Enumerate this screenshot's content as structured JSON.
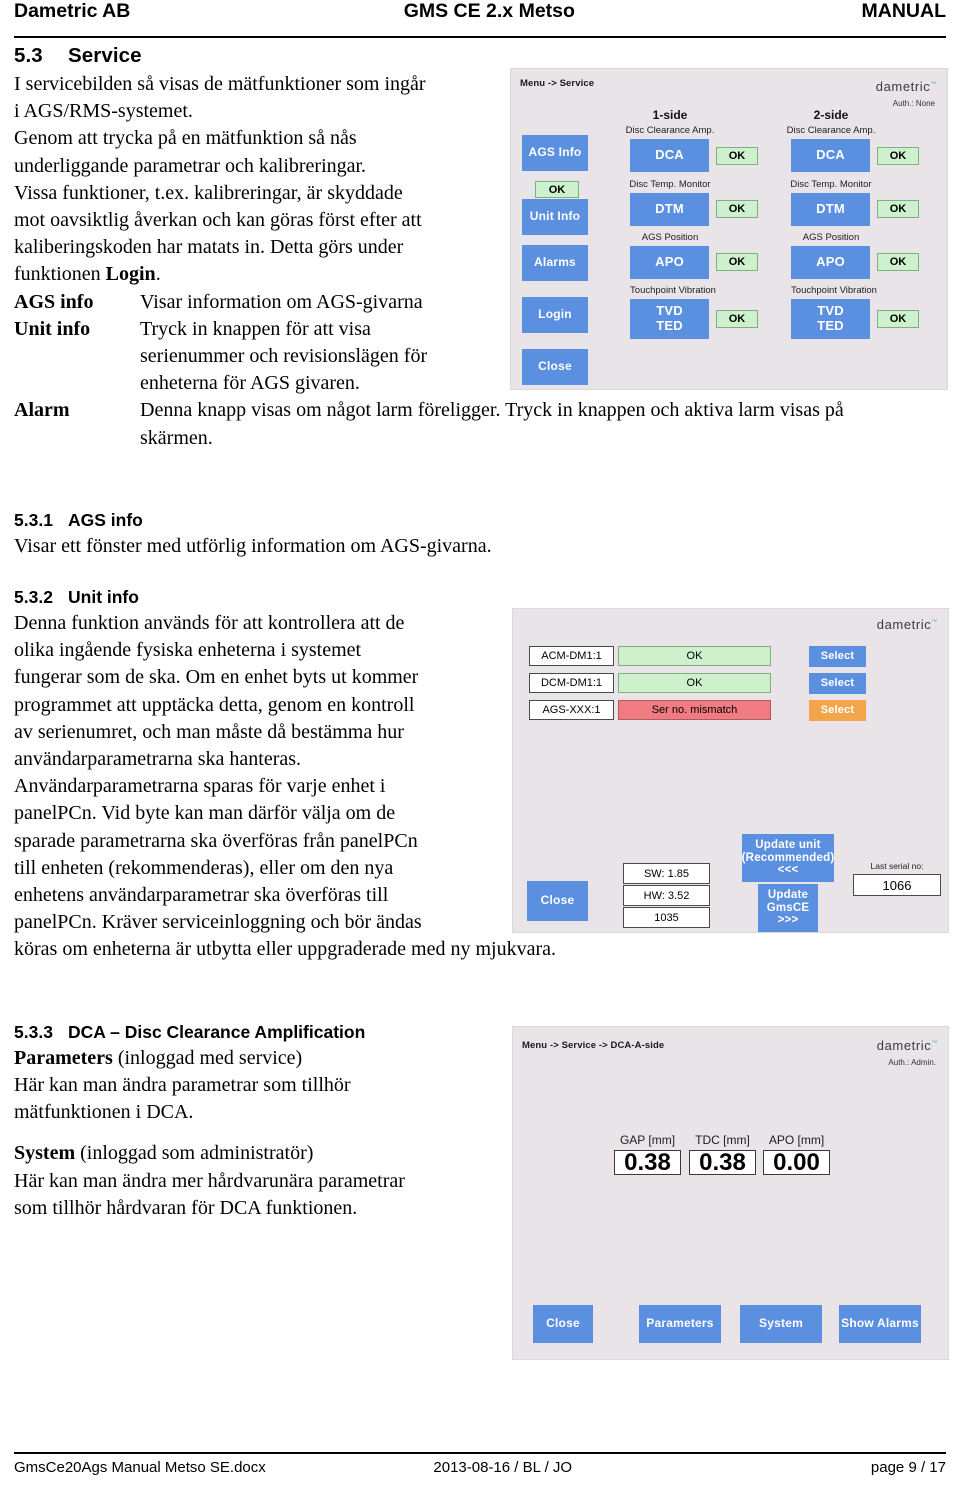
{
  "header": {
    "left": "Dametric AB",
    "middle": "GMS CE 2.x Metso",
    "right": "MANUAL"
  },
  "footer": {
    "file": "GmsCe20Ags Manual Metso SE.docx",
    "date": "2013-08-16 / BL / JO",
    "page": "page 9 / 17"
  },
  "sections": {
    "s53": {
      "number": "5.3",
      "title": "Service",
      "para1_line1": "I servicebilden så visas de mätfunktioner som ingår",
      "para1_line2": "i AGS/RMS-systemet.",
      "para1_line3": "Genom att trycka på en mätfunktion så nås",
      "para1_line4": "underliggande parametrar och kalibreringar.",
      "para1_line5": "Vissa funktioner, t.ex. kalibreringar, är skyddade",
      "para1_line6": "mot oavsiktlig åverkan och kan göras först efter att",
      "para1_line7a": "kaliberingskoden har matats in. Detta görs under",
      "para1_line8a": "funktionen ",
      "para1_line8b": "Login",
      "para1_line8c": ".",
      "defs": [
        {
          "term": "AGS info",
          "desc": "Visar information om AGS-givarna"
        },
        {
          "term": "Unit info",
          "desc_l1": "Tryck in knappen för att visa",
          "desc_l2": "serienummer och revisionslägen för",
          "desc_l3": "enheterna för AGS givaren."
        },
        {
          "term": "Alarm",
          "desc_l1": "Denna knapp visas om något larm föreligger. Tryck in knappen och aktiva larm visas på",
          "desc_l2": "skärmen."
        }
      ]
    },
    "s531": {
      "number": "5.3.1",
      "title": "AGS info",
      "para": "Visar ett fönster med utförlig information om AGS-givarna."
    },
    "s532": {
      "number": "5.3.2",
      "title": "Unit info",
      "lines": [
        "Denna funktion används för att kontrollera att de",
        "olika ingående fysiska enheterna i systemet",
        "fungerar som de ska. Om en enhet byts ut kommer",
        "programmet att upptäcka detta, genom en kontroll",
        "av serienumret, och man måste då bestämma hur",
        "användarparametrarna ska hanteras.",
        "Användarparametrarna sparas för varje enhet i",
        "panelPCn. Vid byte kan man därför välja om de",
        "sparade parametrarna ska överföras från panelPCn",
        "till enheten (rekommenderas), eller om den nya",
        "enhetens användarparametrar ska överföras till",
        "panelPCn. Kräver serviceinloggning och bör ändas"
      ],
      "last_line": "köras om enheterna är utbytta eller uppgraderade med ny mjukvara."
    },
    "s533": {
      "number": "5.3.3",
      "title": "DCA – Disc Clearance Amplification",
      "parameters_bold": "Parameters",
      "parameters_rest": " (inloggad med service)",
      "parameters_l1": "Här kan man ändra parametrar som tillhör",
      "parameters_l2": "mätfunktionen i DCA.",
      "system_bold": "System",
      "system_rest": " (inloggad som administratör)",
      "system_l1": "Här kan man ändra mer hårdvarunära parametrar",
      "system_l2": "som tillhör hårdvaran för DCA funktionen."
    }
  },
  "screenshots": {
    "service": {
      "breadcrumb": "Menu -> Service",
      "brand": "dametric",
      "auth": "Auth.: None",
      "side1_title": "1-side",
      "side2_title": "2-side",
      "left_buttons": [
        {
          "label": "AGS Info"
        },
        {
          "label": "Unit Info"
        },
        {
          "label": "Alarms"
        },
        {
          "label": "Login"
        },
        {
          "label": "Close"
        }
      ],
      "left_status": "OK",
      "rows": [
        {
          "caption": "Disc Clearance Amp.",
          "button": "DCA",
          "status": "OK"
        },
        {
          "caption": "Disc Temp. Monitor",
          "button": "DTM",
          "status": "OK"
        },
        {
          "caption": "AGS Position",
          "button": "APO",
          "status": "OK"
        },
        {
          "caption": "Touchpoint Vibration",
          "button_l1": "TVD",
          "button_l2": "TED",
          "status": "OK"
        }
      ]
    },
    "unitinfo": {
      "brand": "dametric",
      "rows": [
        {
          "name": "ACM-DM1:1",
          "status": "OK",
          "status_kind": "ok",
          "select": "Select",
          "select_kind": "blue"
        },
        {
          "name": "DCM-DM1:1",
          "status": "OK",
          "status_kind": "ok",
          "select": "Select",
          "select_kind": "blue"
        },
        {
          "name": "AGS-XXX:1",
          "status": "Ser no. mismatch",
          "status_kind": "bad",
          "select": "Select",
          "select_kind": "orange"
        }
      ],
      "close_label": "Close",
      "sw": "SW: 1.85",
      "hw": "HW: 3.52",
      "serial": "1035",
      "update_unit_l1": "Update unit",
      "update_unit_l2": "(Recommended)",
      "update_unit_l3": "<<<",
      "update_gms_l1": "Update",
      "update_gms_l2": "GmsCE",
      "update_gms_l3": ">>>",
      "last_serial_label": "Last serial no:",
      "last_serial_value": "1066"
    },
    "dca": {
      "breadcrumb": "Menu -> Service -> DCA-A-side",
      "brand": "dametric",
      "auth": "Auth.: Admin.",
      "values": [
        {
          "label": "GAP [mm]",
          "value": "0.38"
        },
        {
          "label": "TDC [mm]",
          "value": "0.38"
        },
        {
          "label": "APO [mm]",
          "value": "0.00"
        }
      ],
      "buttons": [
        {
          "label": "Close"
        },
        {
          "label": "Parameters"
        },
        {
          "label": "System"
        },
        {
          "label": "Show Alarms"
        }
      ]
    }
  },
  "colors": {
    "button_blue": "#5b8fe0",
    "button_orange": "#f2a54b",
    "status_ok_bg": "#cdf0cd",
    "status_bad_bg": "#f07b82",
    "panel_bg": "#e8e4e8"
  }
}
